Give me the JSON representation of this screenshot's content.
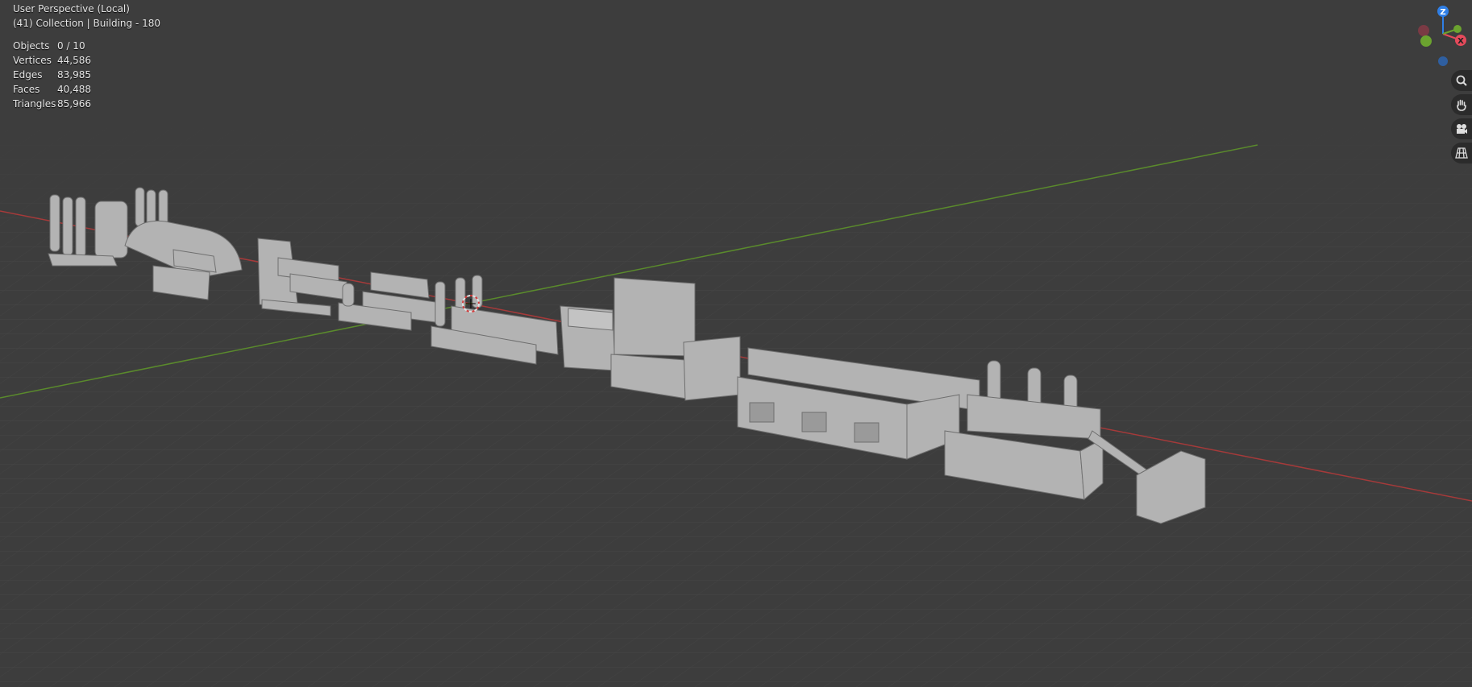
{
  "viewport": {
    "perspective_label": "User Perspective (Local)",
    "collection_label": "(41) Collection | Building - 180"
  },
  "stats": [
    {
      "label": "Objects",
      "value": "0 / 10"
    },
    {
      "label": "Vertices",
      "value": "44,586"
    },
    {
      "label": "Edges",
      "value": "83,985"
    },
    {
      "label": "Faces",
      "value": "40,488"
    },
    {
      "label": "Triangles",
      "value": "85,966"
    }
  ],
  "gizmo": {
    "axes": [
      {
        "label": "Z",
        "color": "#2f7fe6"
      },
      {
        "label": "X",
        "color": "#e64a5b"
      },
      {
        "label": "Y",
        "color": "#6ba32f"
      }
    ]
  },
  "nav_buttons": [
    {
      "icon": "zoom-icon"
    },
    {
      "icon": "hand-pan-icon"
    },
    {
      "icon": "camera-icon"
    },
    {
      "icon": "grid-perspective-icon"
    }
  ],
  "colors": {
    "background": "#3d3d3d",
    "grid": "#474747",
    "x_axis": "#a53a3a",
    "y_axis": "#5a8a2c",
    "model": "#b3b3b3"
  }
}
